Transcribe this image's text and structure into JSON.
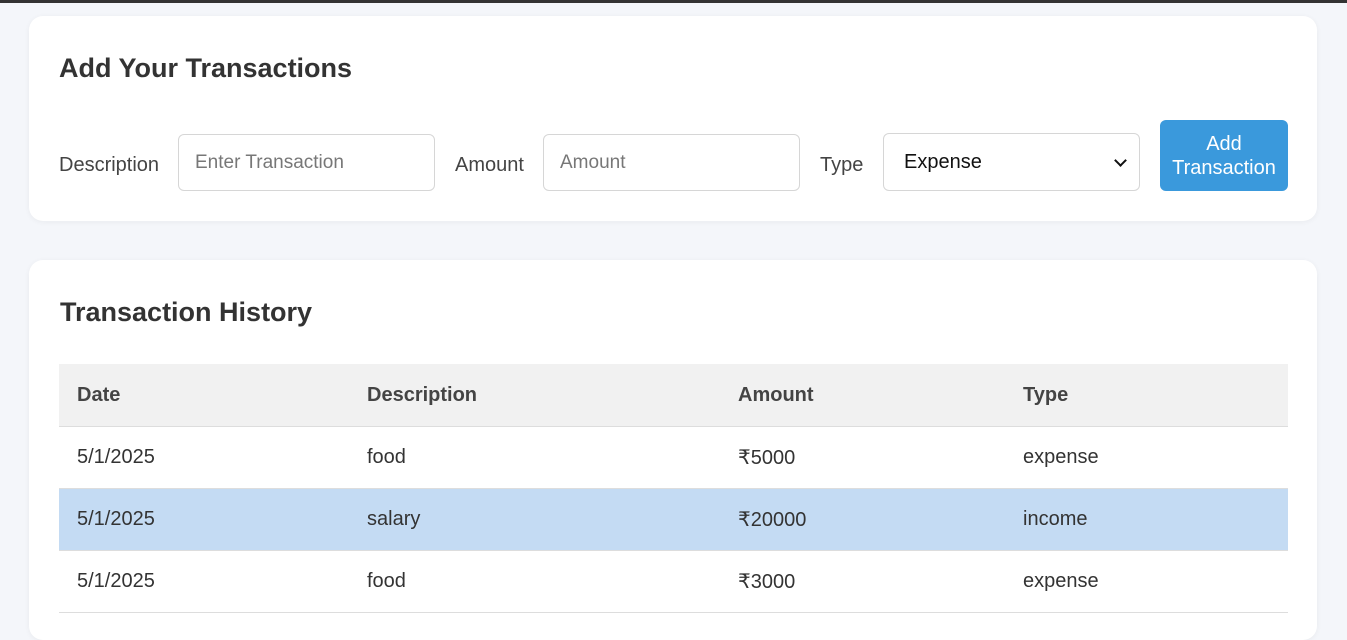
{
  "add_form": {
    "title": "Add Your Transactions",
    "description_label": "Description",
    "description_placeholder": "Enter Transaction",
    "amount_label": "Amount",
    "amount_placeholder": "Amount",
    "type_label": "Type",
    "type_selected": "Expense",
    "submit_label": "Add Transaction"
  },
  "history": {
    "title": "Transaction History",
    "columns": {
      "date": "Date",
      "description": "Description",
      "amount": "Amount",
      "type": "Type"
    },
    "rows": [
      {
        "date": "5/1/2025",
        "description": "food",
        "amount": "₹5000",
        "type": "expense"
      },
      {
        "date": "5/1/2025",
        "description": "salary",
        "amount": "₹20000",
        "type": "income"
      },
      {
        "date": "5/1/2025",
        "description": "food",
        "amount": "₹3000",
        "type": "expense"
      }
    ]
  },
  "colors": {
    "accent": "#3a99dc",
    "selected_row": "#c4dbf3",
    "page_background": "#f4f6fa"
  }
}
